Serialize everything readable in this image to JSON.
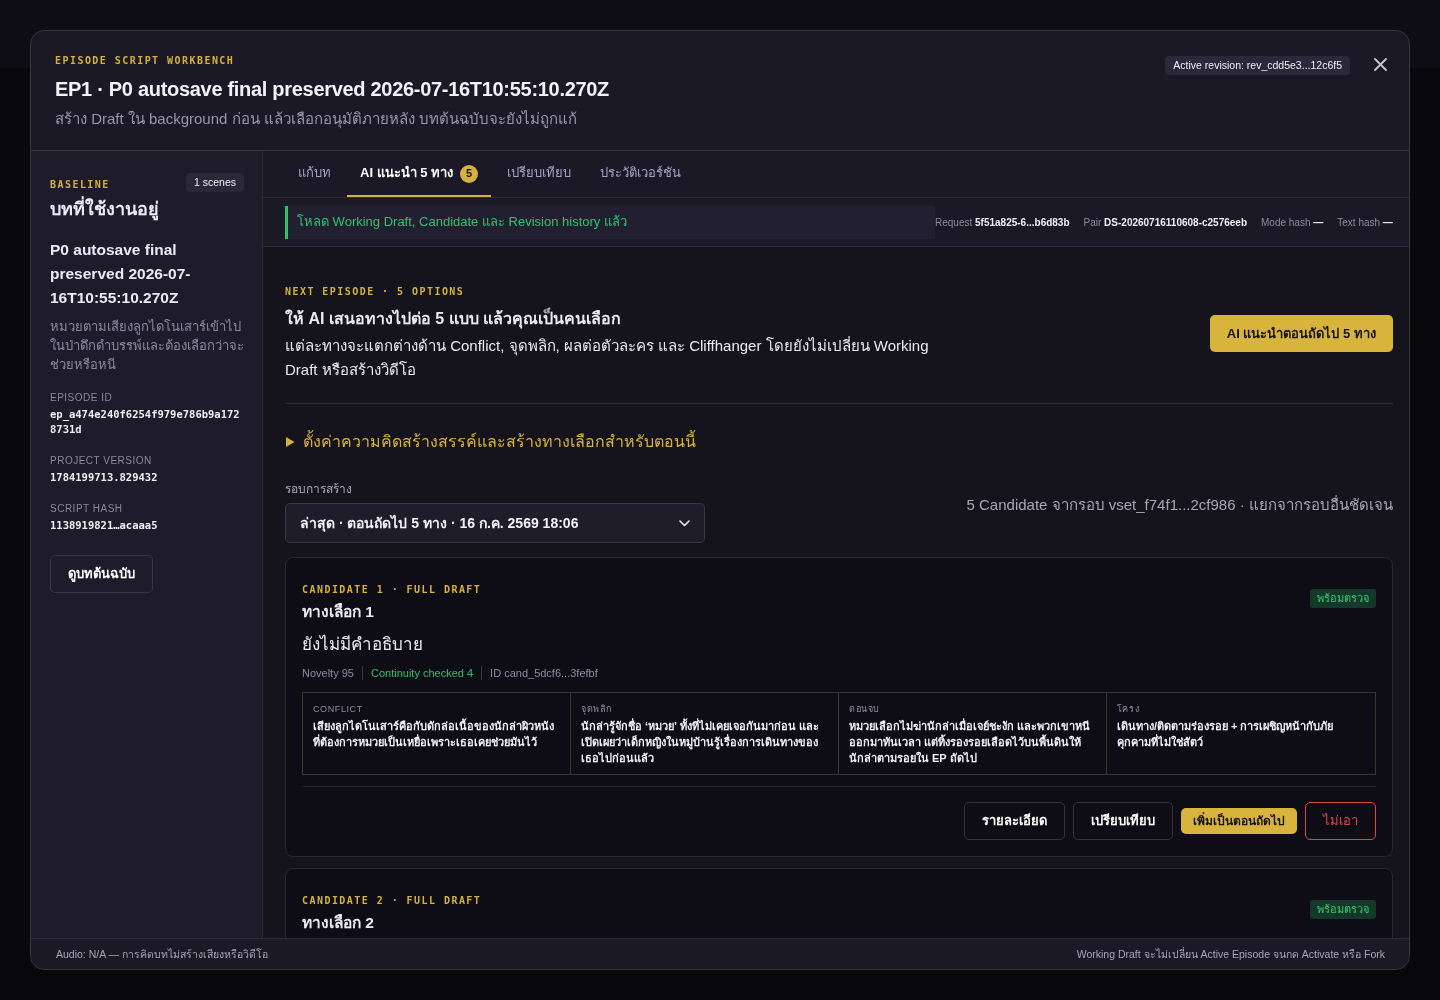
{
  "window": {
    "kicker": "EPISODE SCRIPT WORKBENCH",
    "title": "EP1 · P0 autosave final preserved 2026-07-16T10:55:10.270Z",
    "subtitle": "สร้าง Draft ใน background ก่อน แล้วเลือกอนุมัติภายหลัง บทต้นฉบับจะยังไม่ถูกแก้",
    "active_revision": "Active revision: rev_cdd5e3...12c6f5"
  },
  "sidebar": {
    "kicker": "BASELINE",
    "scene_count": "1 scenes",
    "heading": "บทที่ใช้งานอยู่",
    "episode_title": "P0 autosave final preserved 2026-07-16T10:55:10.270Z",
    "summary": "หมวยตามเสียงลูกไดโนเสาร์เข้าไปในป่าดึกดำบรรพ์และต้องเลือกว่าจะช่วยหรือหนี",
    "fields": [
      {
        "label": "EPISODE ID",
        "value": "ep_a474e240f6254f979e786b9a1728731d"
      },
      {
        "label": "PROJECT VERSION",
        "value": "1784199713.829432"
      },
      {
        "label": "SCRIPT HASH",
        "value": "1138919821…acaaa5"
      }
    ],
    "button": "ดูบทต้นฉบับ"
  },
  "tabs": [
    {
      "label": "แก้บท",
      "selected": false
    },
    {
      "label": "AI แนะนำ 5 ทาง",
      "count": "5",
      "selected": true
    },
    {
      "label": "เปรียบเทียบ",
      "selected": false
    },
    {
      "label": "ประวัติเวอร์ชัน",
      "selected": false
    }
  ],
  "status": {
    "message": "โหลด Working Draft, Candidate และ Revision history แล้ว",
    "meta": [
      {
        "label": "Request",
        "value": "5f51a825-6...b6d83b"
      },
      {
        "label": "Pair",
        "value": "DS-20260716110608-c2576eeb"
      },
      {
        "label": "Mode hash",
        "value": "—"
      },
      {
        "label": "Text hash",
        "value": "—"
      }
    ]
  },
  "suggestions": {
    "kicker": "NEXT EPISODE · 5 OPTIONS",
    "heading": "ให้ AI เสนอทางไปต่อ 5 แบบ แล้วคุณเป็นคนเลือก",
    "description": "แต่ละทางจะแตกต่างด้าน Conflict, จุดพลิก, ผลต่อตัวละคร และ Cliffhanger โดยยังไม่เปลี่ยน Working Draft หรือสร้างวิดีโอ",
    "button": "AI แนะนำตอนถัดไป 5 ทาง",
    "settings": {
      "label": "ตั้งค่าความคิดสร้างสรรค์และสร้างทางเลือกสำหรับตอนนี้",
      "expanded": false
    },
    "round": {
      "label": "รอบการสร้าง",
      "value": "ล่าสุด · ตอนถัดไป 5 ทาง · 16 ก.ค. 2569 18:06"
    },
    "round_note": "5 Candidate จากรอบ vset_f74f1...2cf986 · แยกจากรอบอื่นชัดเจน"
  },
  "candidates": [
    {
      "kicker": "CANDIDATE 1 · FULL DRAFT",
      "title": "ทางเลือก 1",
      "status": {
        "label": "พร้อมตรวจ",
        "kind": "ready"
      },
      "description": "ยังไม่มีคำอธิบาย",
      "meta": [
        {
          "text": "Novelty 95",
          "kind": "plain"
        },
        {
          "text": "Continuity checked 4",
          "kind": "ok"
        },
        {
          "text": "ID cand_5dcf6...3fefbf",
          "kind": "plain"
        }
      ],
      "fields": [
        {
          "label": "CONFLICT",
          "value": "เสียงลูกไดโนเสาร์คือกับดักล่อเนื้อของนักล่าผิวหนังที่ต้องการหมวยเป็นเหยื่อเพราะเธอเคยช่วยมันไว้"
        },
        {
          "label": "จุดพลิก",
          "value": "นักล่ารู้จักชื่อ ‘หมวย’ ทั้งที่ไม่เคยเจอกันมาก่อน และเปิดเผยว่าเด็กหญิงในหมู่บ้านรู้เรื่องการเดินทางของเธอไปก่อนแล้ว"
        },
        {
          "label": "ตอนจบ",
          "value": "หมวยเลือกไม่ฆ่านักล่าเมื่อเจย์ชะงัก และพวกเขาหนีออกมาทันเวลา แต่ทิ้งรองรอยเลือดไว้บนพื้นดินให้นักล่าตามรอยใน EP ถัดไป"
        },
        {
          "label": "โครง",
          "value": "เดินทาง/ติดตามร่องรอย + การเผชิญหน้ากับภัยคุกคามที่ไม่ใช่สัตว์"
        }
      ],
      "actions": [
        {
          "label": "รายละเอียด",
          "kind": "outline"
        },
        {
          "label": "เปรียบเทียบ",
          "kind": "outline"
        },
        {
          "label": "เพิ่มเป็นตอนถัดไป",
          "kind": "primary"
        },
        {
          "label": "ไม่เอา",
          "kind": "danger"
        }
      ]
    },
    {
      "kicker": "CANDIDATE 2 · FULL DRAFT",
      "title": "ทางเลือก 2",
      "status": {
        "label": "พร้อมตรวจ",
        "kind": "ready"
      }
    }
  ],
  "footer": {
    "left": "Audio: N/A — การคิดบทไม่สร้างเสียงหรือวิดีโอ",
    "right": "Working Draft จะไม่เปลี่ยน Active Episode จนกด Activate หรือ Fork"
  }
}
